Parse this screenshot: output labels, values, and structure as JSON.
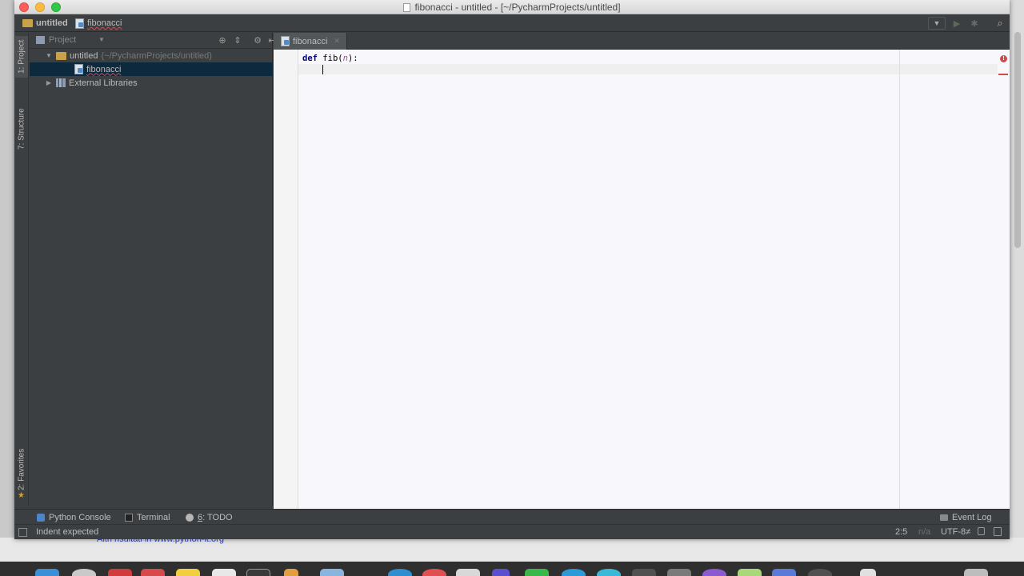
{
  "window": {
    "title": "fibonacci - untitled - [~/PycharmProjects/untitled]"
  },
  "navbar": {
    "project": "untitled",
    "file": "fibonacci"
  },
  "left_stripe": {
    "project_tab": "1: Project",
    "structure_tab": "7: Structure",
    "favorites_tab": "2: Favorites"
  },
  "project_panel": {
    "view": "Project",
    "tree": {
      "root_label": "untitled",
      "root_path": "(~/PycharmProjects/untitled)",
      "file_label": "fibonacci",
      "libs_label": "External Libraries"
    }
  },
  "editor": {
    "tab_label": "fibonacci",
    "code": {
      "kw_def": "def",
      "func_name": "fib",
      "open_paren": "(",
      "param": "n",
      "close": "):"
    }
  },
  "bottom_tools": {
    "python_console": "Python Console",
    "terminal": "Terminal",
    "todo_num": "6",
    "todo_text": ": TODO",
    "event_log": "Event Log"
  },
  "status": {
    "message": "Indent expected",
    "position": "2:5",
    "separator": "n/a",
    "encoding": "UTF-8≠"
  },
  "background": {
    "search_link": "Altri risultati in www.python-it.org"
  },
  "colors": {
    "editor_bg": "#f8f8fc",
    "ide_bg": "#3c3f41",
    "selection": "#0d293e",
    "error": "#d24b4b",
    "keyword": "#000080"
  }
}
